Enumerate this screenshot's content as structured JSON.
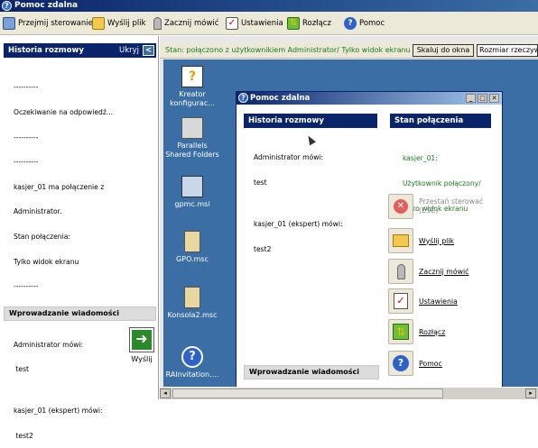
{
  "window": {
    "title": "Pomoc zdalna"
  },
  "toolbar": {
    "items": [
      {
        "label": "Przejmij sterowanie",
        "icon": "take-control-icon"
      },
      {
        "label": "Wyślij plik",
        "icon": "send-file-icon"
      },
      {
        "label": "Zacznij mówić",
        "icon": "microphone-icon"
      },
      {
        "label": "Ustawienia",
        "icon": "settings-checklist-icon"
      },
      {
        "label": "Rozłącz",
        "icon": "disconnect-icon"
      },
      {
        "label": "Pomoc",
        "icon": "help-icon"
      }
    ]
  },
  "left_panel": {
    "history_title": "Historia rozmowy",
    "hide_label": "Ukryj",
    "chat_lines": [
      "----------",
      "Oczekiwanie na odpowiedź...",
      "----------",
      "----------",
      "kasjer_01 ma połączenie z",
      "Administrator.",
      "Stan połączenia:",
      "Tylko widok ekranu",
      "----------",
      "",
      "",
      "Administrator mówi:",
      " test",
      "",
      "kasjer_01 (ekspert) mówi:",
      " test2"
    ],
    "input_title": "Wprowadzanie wiadomości",
    "send_label": "Wyślij"
  },
  "status_bar": {
    "status_text": "Stan: połączono z użytkownikiem Administrator/ Tylko widok ekranu",
    "scale_button": "Skaluj do okna",
    "size_select": "Rozmiar rzeczywis"
  },
  "desktop_icons": [
    {
      "label": "Kreator konfigurac...",
      "icon": "wizard-icon"
    },
    {
      "label": "Parallels Shared Folders",
      "icon": "shared-folders-icon"
    },
    {
      "label": "gpmc.msi",
      "icon": "msi-installer-icon"
    },
    {
      "label": "GPO.msc",
      "icon": "msc-console-icon"
    },
    {
      "label": "Konsola2.msc",
      "icon": "msc-console-icon"
    },
    {
      "label": "RAInvitation....",
      "icon": "help-invitation-icon"
    }
  ],
  "inner_dialog": {
    "title": "Pomoc zdalna",
    "history_title": "Historia rozmowy",
    "chat_lines": [
      "Administrator mówi:",
      "test",
      "",
      "kasjer_01 (ekspert) mówi:",
      "test2"
    ],
    "status_title": "Stan połączenia",
    "status_lines": [
      "kasjer_01:",
      "Użytkownik połączony/",
      "Tylko widok ekranu"
    ],
    "input_title": "Wprowadzanie wiadomości",
    "buttons": [
      {
        "label": "Przestań sterować (ESC)",
        "icon": "stop-control-icon",
        "disabled": true
      },
      {
        "label": "Wyślij plik",
        "icon": "send-file-icon"
      },
      {
        "label": "Zacznij mówić",
        "icon": "microphone-icon"
      },
      {
        "label": "Ustawienia",
        "icon": "settings-checklist-icon"
      },
      {
        "label": "Rozłącz",
        "icon": "disconnect-icon"
      },
      {
        "label": "Pomoc",
        "icon": "help-icon"
      }
    ]
  },
  "colors": {
    "title_blue": "#0a246a",
    "desktop_blue": "#3a6ea5",
    "status_green": "#1b7a1b"
  }
}
